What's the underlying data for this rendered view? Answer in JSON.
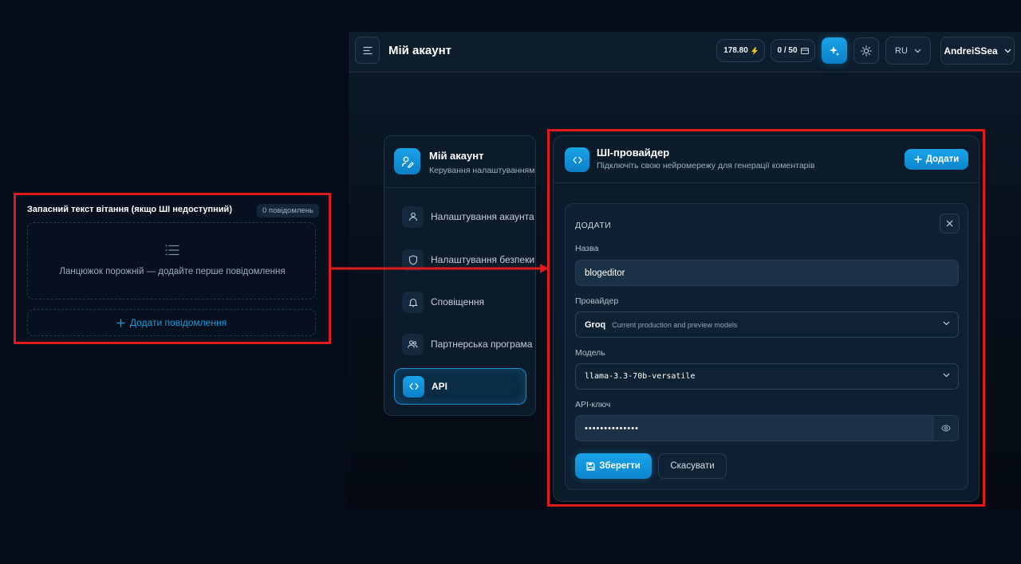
{
  "header": {
    "title": "Мій акаунт",
    "balance": "178.80",
    "balance_icon": "lightning-icon",
    "usage": "0 / 50",
    "usage_icon": "card-icon",
    "ai_button_icon": "sparkles-icon",
    "theme_icon": "sun-icon",
    "language": "RU",
    "username": "AndreiSSea"
  },
  "sidebar": {
    "title": "Мій акаунт",
    "subtitle": "Керування налаштуваннями",
    "items": [
      {
        "label": "Налаштування акаунта",
        "icon": "user-icon",
        "active": false
      },
      {
        "label": "Налаштування безпеки",
        "icon": "shield-icon",
        "active": false
      },
      {
        "label": "Сповіщення",
        "icon": "bell-icon",
        "active": false
      },
      {
        "label": "Партнерська програма",
        "icon": "users-icon",
        "active": false
      },
      {
        "label": "API",
        "icon": "code-icon",
        "active": true
      }
    ]
  },
  "provider_card": {
    "title": "ШІ-провайдер",
    "subtitle": "Підключіть свою нейромережу для генерації коментарів",
    "add_label": "Додати",
    "form": {
      "heading": "ДОДАТИ",
      "name_label": "Назва",
      "name_value": "blogeditor",
      "provider_label": "Провайдер",
      "provider_value": "Groq",
      "provider_hint": "Current production and preview models",
      "model_label": "Модель",
      "model_value": "llama-3.3-70b-versatile",
      "api_key_label": "API-ключ",
      "api_key_value": "••••••••••••••",
      "save_label": "Зберегти",
      "cancel_label": "Скасувати"
    }
  },
  "fallback_panel": {
    "title": "Запасний текст вітання (якщо ШІ недоступний)",
    "badge": "0 повідомлень",
    "empty_text": "Ланцюжок порожній — додайте перше повідомлення",
    "add_label": "Додати повідомлення"
  },
  "colors": {
    "accent": "#1aa3e8",
    "highlight": "#e01b1b",
    "background": "#060b1a"
  }
}
